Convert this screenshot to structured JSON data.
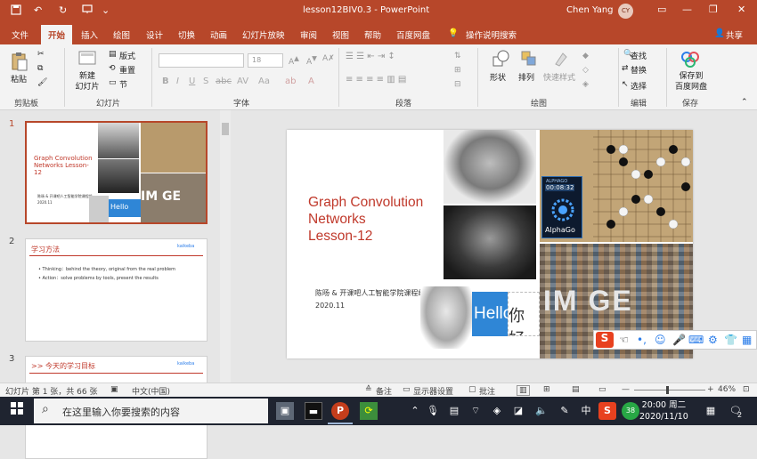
{
  "titlebar": {
    "document_title": "lesson12BIV0.3  -  PowerPoint",
    "user_name": "Chen Yang",
    "user_initials": "CY"
  },
  "tabs": [
    "文件",
    "开始",
    "插入",
    "绘图",
    "设计",
    "切换",
    "动画",
    "幻灯片放映",
    "审阅",
    "视图",
    "帮助",
    "百度网盘"
  ],
  "active_tab": "开始",
  "tell_me": "操作说明搜索",
  "share": "共享",
  "ribbon": {
    "clipboard": {
      "paste": "粘贴",
      "label": "剪贴板"
    },
    "slides": {
      "new_slide": "新建\n幻灯片",
      "layout": "版式",
      "reset": "重置",
      "section": "节",
      "label": "幻灯片"
    },
    "font": {
      "size": "18",
      "label": "字体"
    },
    "paragraph": {
      "label": "段落"
    },
    "drawing": {
      "shapes": "形状",
      "arrange": "排列",
      "quick_styles": "快速样式",
      "label": "绘图"
    },
    "editing": {
      "find": "查找",
      "replace": "替换",
      "select": "选择",
      "label": "编辑"
    },
    "save": {
      "save_to": "保存到\n百度网盘",
      "label": "保存"
    }
  },
  "thumbnails": [
    {
      "number": "1",
      "title": "Graph Convolution Networks Lesson-12",
      "subtitle": "陈旸 & 开课吧人工智能学院课程组",
      "date": "2020.11"
    },
    {
      "number": "2",
      "heading": "学习方法",
      "bullets": [
        "Thinking：behind the theory, original from the real problem",
        "Action：solve problems by tools, present the results"
      ],
      "logo": "kaikeba"
    },
    {
      "number": "3",
      "heading": ">>  今天的学习目标",
      "logo": "kaikeba"
    }
  ],
  "slide": {
    "title_lines": [
      "Graph Convolution",
      "Networks",
      "Lesson-12"
    ],
    "author": "陈旸 & 开课吧人工智能学院课程组",
    "date": "2020.11",
    "alphago_label": "ALPHAGO",
    "alphago_timer": "00:08:32",
    "alphago_name": "AlphaGo",
    "image_text": "IM  GE",
    "hello_text": "Hello",
    "nihao_text": "你好"
  },
  "statusbar": {
    "slide_info": "幻灯片 第 1 张，共 66 张",
    "language": "中文(中国)",
    "notes": "备注",
    "display_settings": "显示器设置",
    "comments": "批注",
    "zoom": "46%"
  },
  "taskbar": {
    "search_placeholder": "在这里输入你要搜索的内容",
    "time": "20:00 周二",
    "date": "2020/11/10",
    "ime_lang": "中",
    "badge_38": "38",
    "notif_count": "2"
  },
  "colors": {
    "accent": "#b7472a",
    "slide_title": "#c0392b",
    "taskbar": "#1f2430"
  }
}
